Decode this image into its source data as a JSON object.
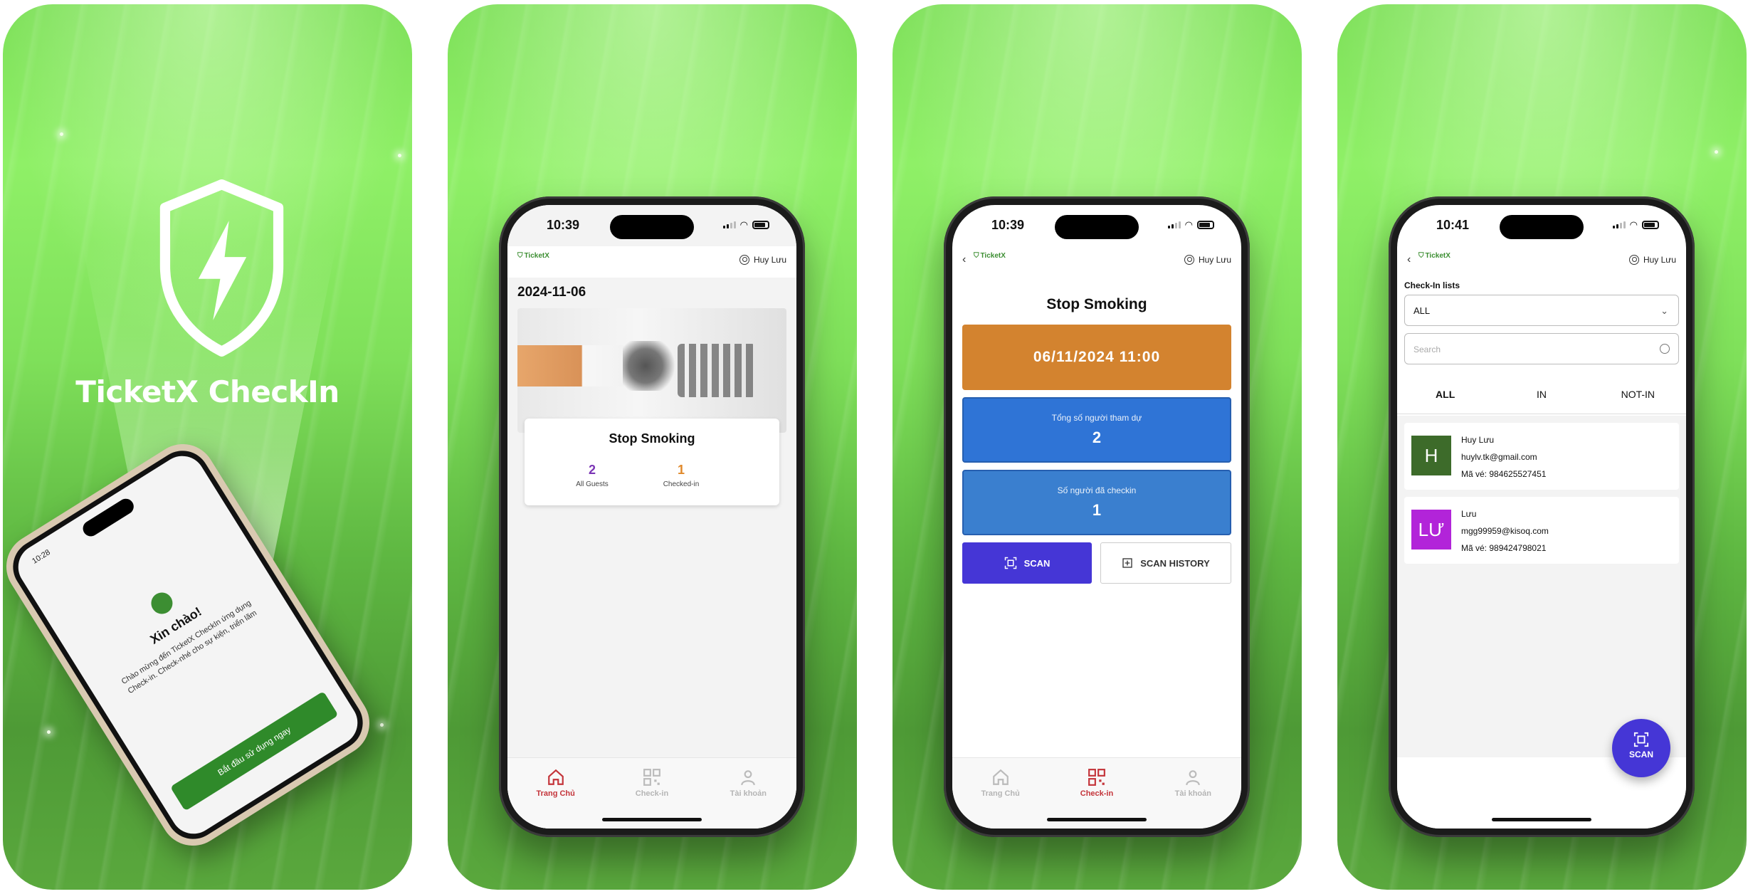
{
  "panel1": {
    "title": "TicketX CheckIn",
    "tilted_phone": {
      "time": "10:28",
      "greeting": "Xin chào!",
      "subtitle": "Chào mừng đến TicketX CheckIn ứng dụng Check-in. Check-nhé cho sự kiện, triển lãm",
      "button": "Bắt đầu sử dụng ngay"
    }
  },
  "screen2": {
    "time": "10:39",
    "logo": "TicketX",
    "user": "Huy Lưu",
    "date": "2024-11-06",
    "event_title": "Stop Smoking",
    "stats": [
      {
        "value": "2",
        "label": "All Guests",
        "color": "#7b35b5"
      },
      {
        "value": "1",
        "label": "Checked-in",
        "color": "#e0892b"
      }
    ]
  },
  "screen3": {
    "time": "10:39",
    "logo": "TicketX",
    "user": "Huy Lưu",
    "title": "Stop Smoking",
    "datetime": "06/11/2024  11:00",
    "total_label": "Tổng số người tham dự",
    "total_value": "2",
    "checked_label": "Số người đã checkin",
    "checked_value": "1",
    "scan_label": "SCAN",
    "history_label": "SCAN HISTORY"
  },
  "screen4": {
    "time": "10:41",
    "logo": "TicketX",
    "user": "Huy Lưu",
    "list_label": "Check-In lists",
    "select_value": "ALL",
    "search_placeholder": "Search",
    "filters": [
      "ALL",
      "IN",
      "NOT-IN"
    ],
    "guests": [
      {
        "initials": "H",
        "name": "Huy Lưu",
        "email": "huylv.tk@gmail.com",
        "ticket": "Mã vé: 984625527451",
        "color": "#3d6b2a"
      },
      {
        "initials": "LƯ",
        "name": "Lưu",
        "email": "mgg99959@kisoq.com",
        "ticket": "Mã vé: 989424798021",
        "color": "#b224d9"
      }
    ],
    "fab_label": "SCAN"
  },
  "tabs": [
    "Trang Chủ",
    "Check-in",
    "Tài khoản"
  ],
  "colors": {
    "accent_red": "#c4343a",
    "brand_green": "#3c8e32",
    "scan_purple": "#4536d6"
  }
}
